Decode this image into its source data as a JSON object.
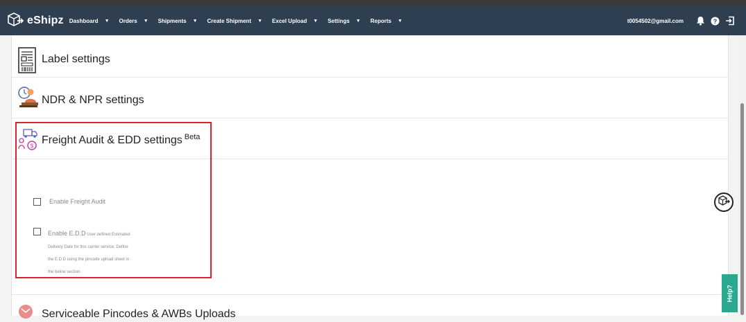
{
  "brand": {
    "name": "eShipz"
  },
  "nav": {
    "items": [
      {
        "label": "Dashboard"
      },
      {
        "label": "Orders"
      },
      {
        "label": "Shipments"
      },
      {
        "label": "Create Shipment"
      },
      {
        "label": "Excel Upload"
      },
      {
        "label": "Settings"
      },
      {
        "label": "Reports"
      }
    ],
    "user_email": "t0054502@gmail.com"
  },
  "sections": {
    "label_settings": {
      "title": "Label settings",
      "icon": "label-barcode-icon"
    },
    "ndr_npr": {
      "title": "NDR & NPR settings",
      "icon": "ndr-person-clock-icon"
    },
    "freight_audit": {
      "title": "Freight Audit & EDD settings",
      "badge": "Beta",
      "icon": "freight-truck-icon",
      "enable_freight_audit": {
        "label": "Enable Freight Audit",
        "checked": false
      },
      "enable_edd": {
        "label": "Enable E.D.D",
        "description_first": "User defined Estimated",
        "description_lines": [
          "Delivery Date for this carrier service. Define",
          "the E.D.D using the pincode upload sheet in",
          "the below section."
        ],
        "checked": false
      }
    },
    "serviceable_pincodes": {
      "title": "Serviceable Pincodes & AWBs Uploads"
    }
  },
  "help": {
    "label": "Help?"
  },
  "colors": {
    "navbar": "#2f3f52",
    "highlight": "#d9232f",
    "help_tab": "#2aa98f"
  }
}
